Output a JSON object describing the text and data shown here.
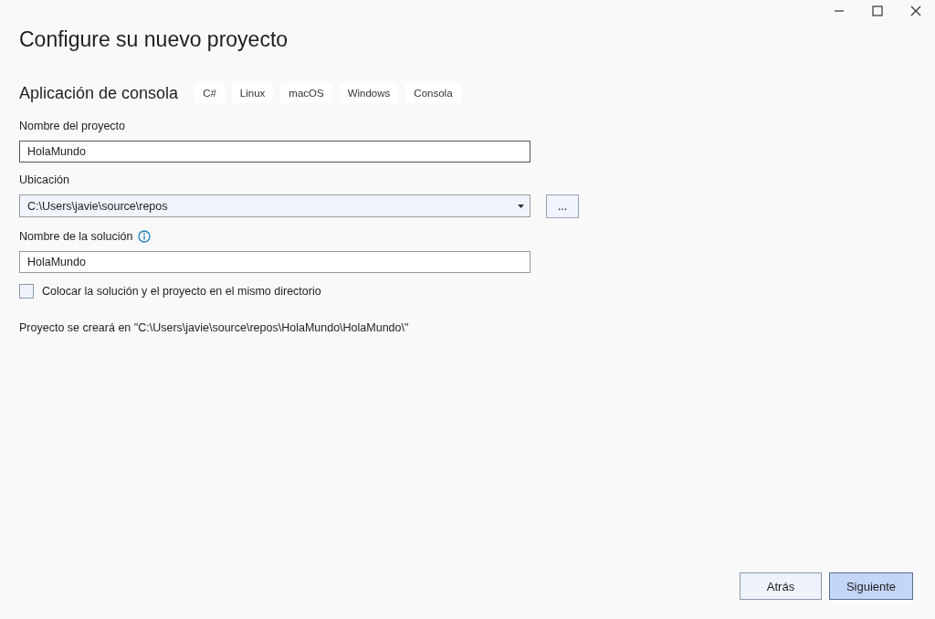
{
  "title": "Configure su nuevo proyecto",
  "template": {
    "name": "Aplicación de consola",
    "tags": [
      "C#",
      "Linux",
      "macOS",
      "Windows",
      "Consola"
    ]
  },
  "project_name": {
    "label": "Nombre del proyecto",
    "value": "HolaMundo"
  },
  "location": {
    "label": "Ubicación",
    "value": "C:\\Users\\javie\\source\\repos",
    "browse": "..."
  },
  "solution_name": {
    "label": "Nombre de la solución",
    "value": "HolaMundo"
  },
  "same_directory": {
    "label": "Colocar la solución y el proyecto en el mismo directorio",
    "checked": false
  },
  "path_note": "Proyecto se creará en \"C:\\Users\\javie\\source\\repos\\HolaMundo\\HolaMundo\\\"",
  "buttons": [
    {
      "label": "Atrás",
      "default": false
    },
    {
      "label": "Siguiente",
      "default": true
    }
  ]
}
